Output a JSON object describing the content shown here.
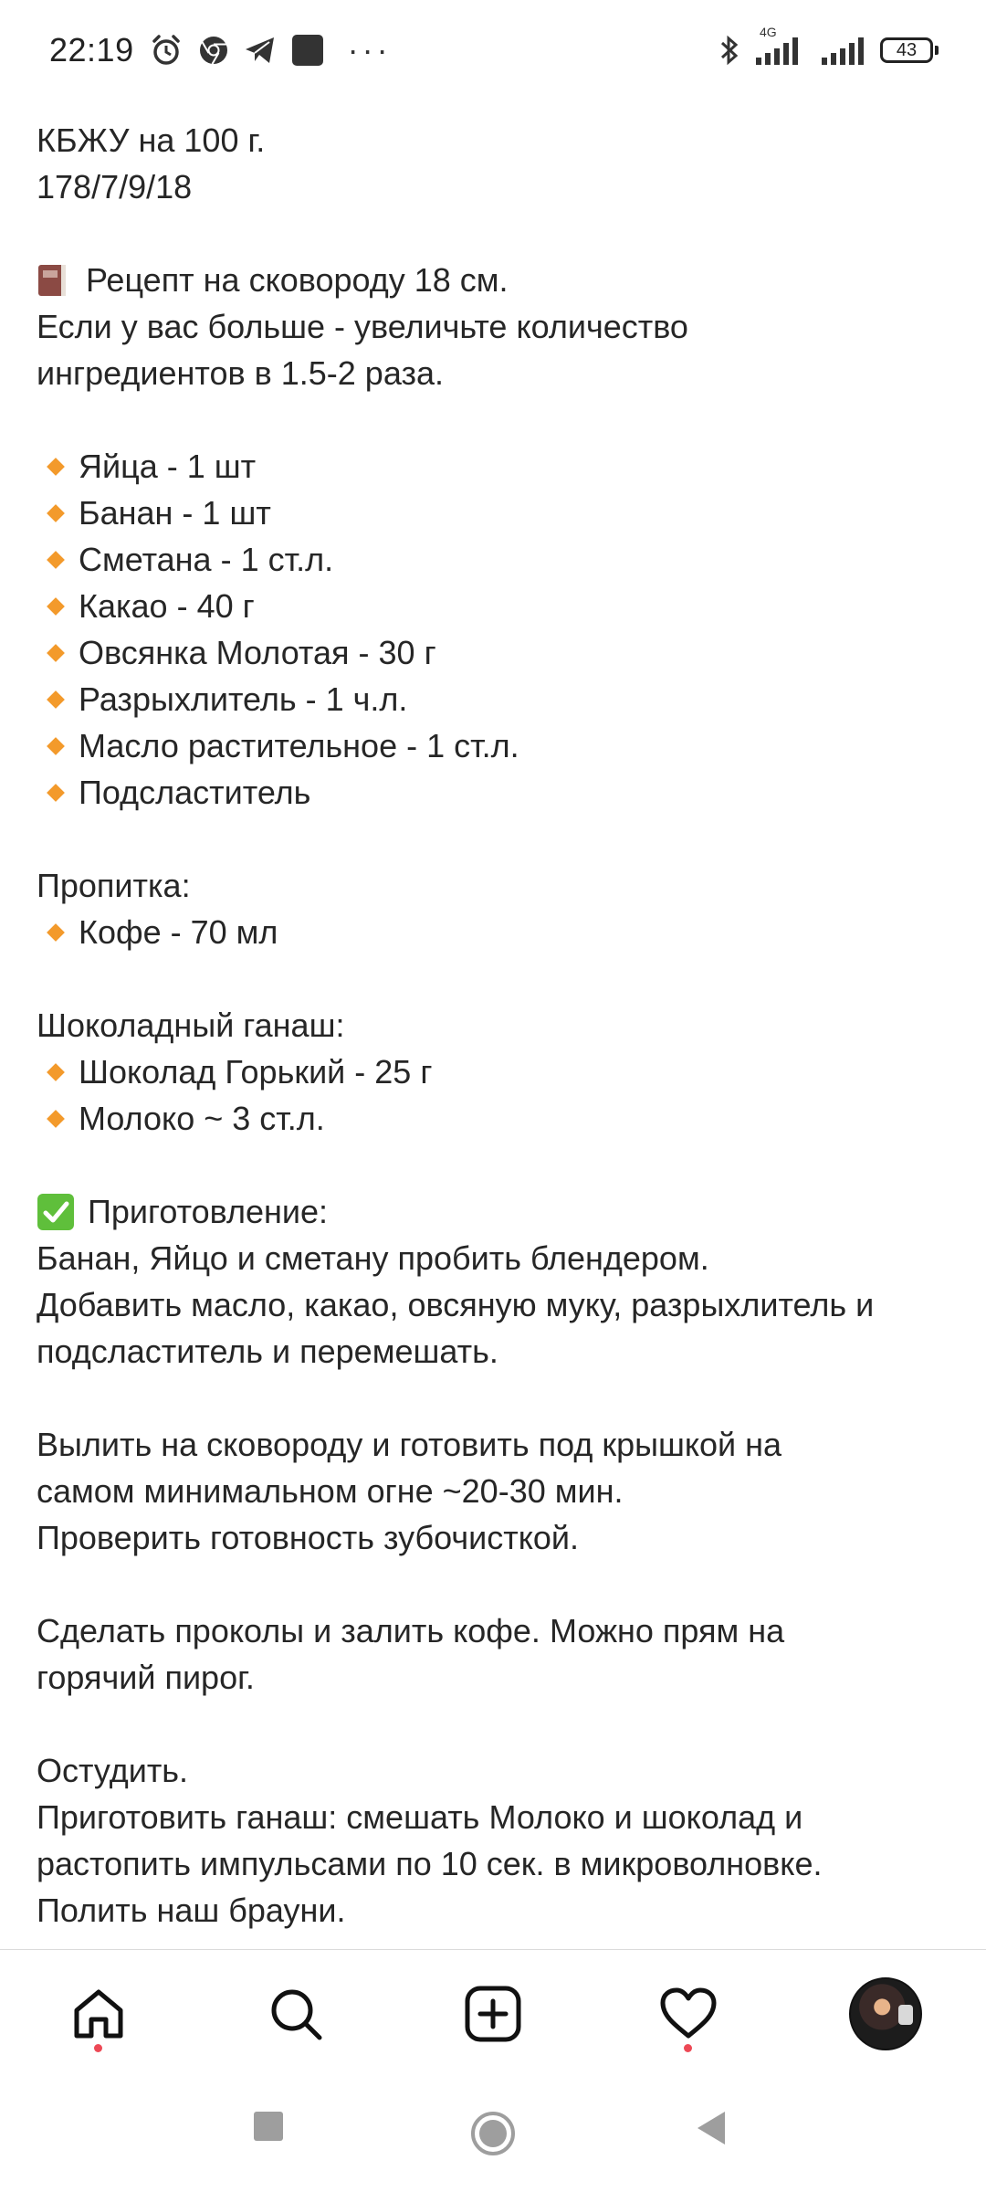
{
  "status_bar": {
    "time": "22:19",
    "left_icons": [
      "alarm-icon",
      "chrome-icon",
      "telegram-icon",
      "app-square-icon"
    ],
    "more": "···",
    "network_label": "4G",
    "battery": "43"
  },
  "post": {
    "nutrition_title": "КБЖУ на 100 г.",
    "nutrition_values": "178/7/9/18",
    "recipe_heading": "Рецепт на сковороду 18 см.",
    "recipe_note_1": "Если у вас больше - увеличьте количество",
    "recipe_note_2": "ингредиентов в 1.5-2 раза.",
    "ingredients": [
      "Яйца - 1 шт",
      "Банан - 1 шт",
      "Сметана - 1 ст.л.",
      "Какао - 40 г",
      "Овсянка Молотая - 30 г",
      "Разрыхлитель - 1 ч.л.",
      "Масло растительное - 1 ст.л.",
      "Подсластитель"
    ],
    "soak_heading": "Пропитка:",
    "soak_items": [
      "Кофе - 70 мл"
    ],
    "ganache_heading": "Шоколадный ганаш:",
    "ganache_items": [
      "Шоколад Горький - 25 г",
      "Молоко ~ 3 ст.л."
    ],
    "prep_heading": "Приготовление:",
    "prep_lines": [
      "Банан, Яйцо и сметану пробить блендером.",
      "Добавить масло, какао, овсяную муку, разрыхлитель и",
      "подсластитель и перемешать.",
      "",
      "Вылить на сковороду и готовить под крышкой на",
      "самом минимальном огне ~20-30 мин.",
      "Проверить готовность зубочисткой.",
      "",
      "Сделать проколы и залить кофе. Можно прям на",
      "горячий пирог.",
      "",
      "Остудить.",
      "Приготовить ганаш: смешать Молоко и шоколад и",
      "растопить импульсами по 10 сек. в микроволновке.",
      "Полить наш брауни."
    ]
  },
  "bottom_nav": {
    "items": [
      "home-icon",
      "search-icon",
      "create-icon",
      "activity-icon",
      "profile-avatar"
    ]
  },
  "colors": {
    "bullet": "#f39a2b",
    "notification_dot": "#ed4956",
    "check_green": "#5fbf3b",
    "text": "#262626"
  }
}
